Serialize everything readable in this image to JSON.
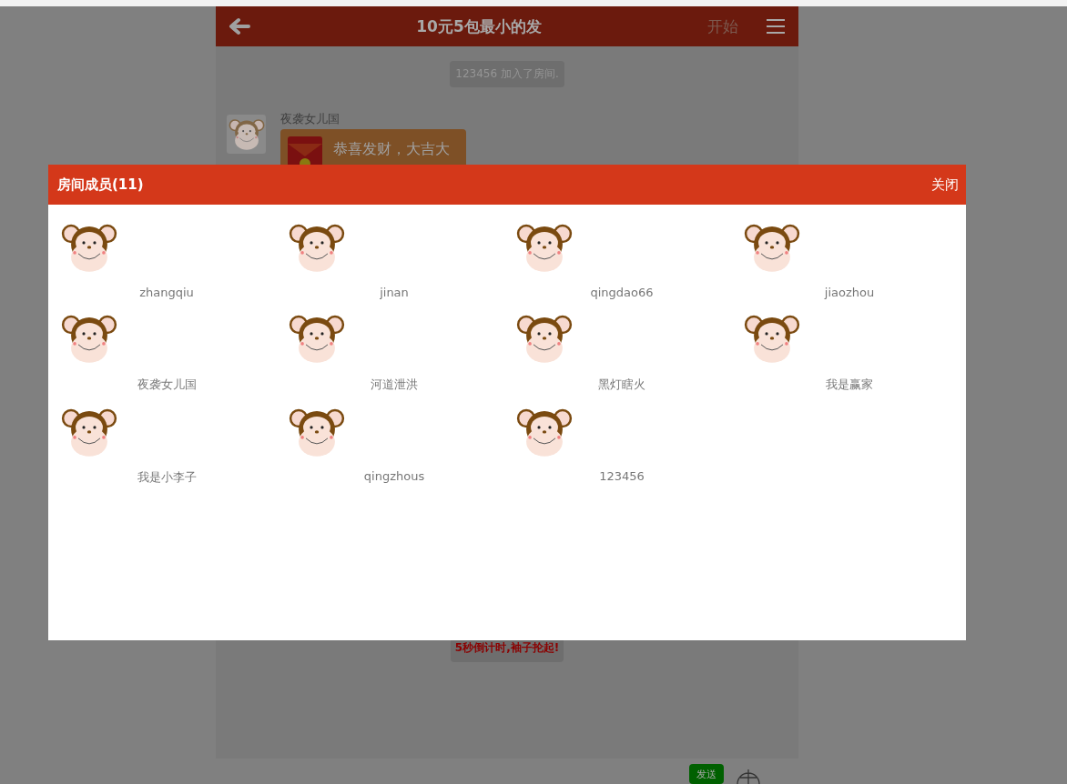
{
  "chat": {
    "title": "10元5包最小的发",
    "start_label": "开始",
    "messages": [
      {
        "kind": "system",
        "text": "123456 加入了房间."
      },
      {
        "kind": "packet",
        "sender": "夜袭女儿国",
        "text": "恭喜发财，大吉大"
      },
      {
        "kind": "notice",
        "text": "5秒倒计时,袖子抡起!"
      }
    ],
    "send_label": "发送"
  },
  "members_dialog": {
    "title": "房间成员(11)",
    "close_label": "关闭",
    "members": [
      {
        "name": "zhangqiu"
      },
      {
        "name": "jinan"
      },
      {
        "name": "qingdao66"
      },
      {
        "name": "jiaozhou"
      },
      {
        "name": "夜袭女儿国"
      },
      {
        "name": "河道泄洪"
      },
      {
        "name": "黑灯瞎火"
      },
      {
        "name": "我是赢家"
      },
      {
        "name": "我是小李子"
      },
      {
        "name": "qingzhous"
      },
      {
        "name": "123456"
      }
    ]
  }
}
